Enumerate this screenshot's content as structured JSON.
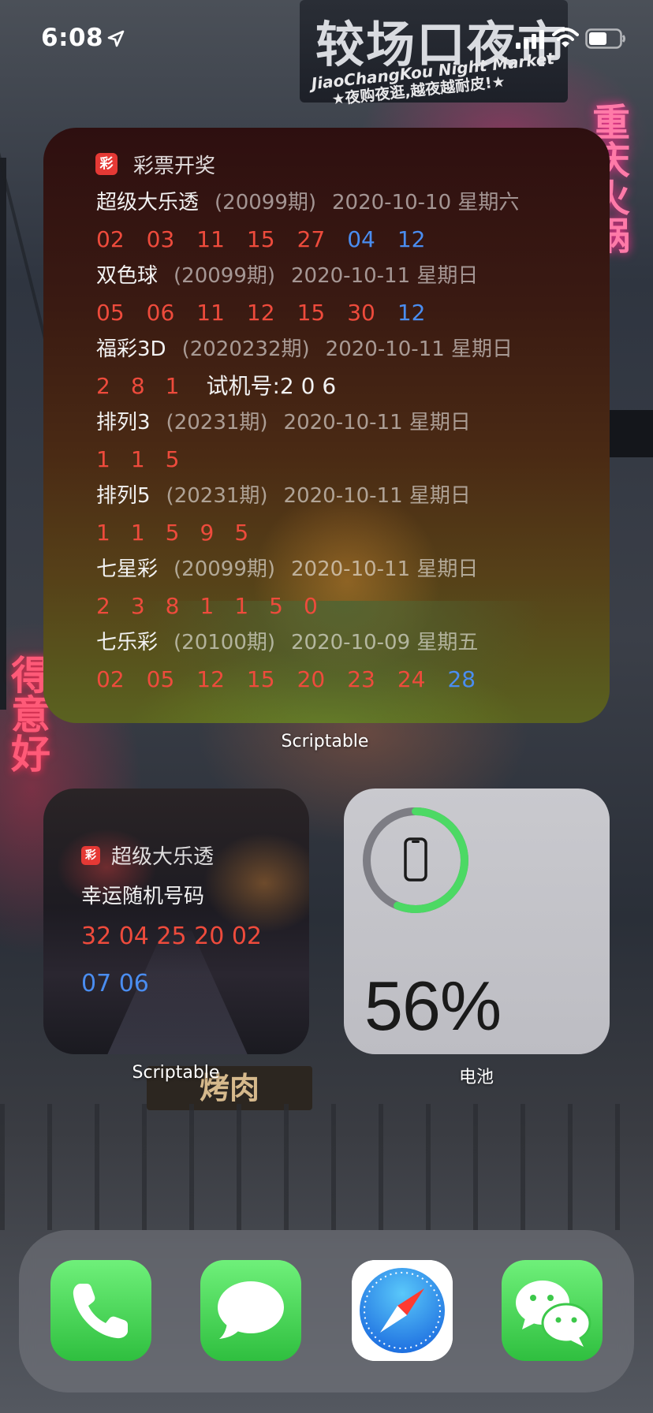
{
  "status_bar": {
    "time": "6:08",
    "icons": [
      "location-icon",
      "signal-icon",
      "wifi-icon",
      "battery-icon"
    ]
  },
  "wallpaper": {
    "sign_big": "较场口夜市",
    "sign_sub1": "JiaoChangKou Night Market",
    "sign_sub2": "★夜购夜逛,越夜越耐皮!★",
    "left_neon": "得意好",
    "right_neon": "重庆火锅",
    "bbq_sign": "烤肉"
  },
  "lottery_widget": {
    "badge": "彩",
    "title": "彩票开奖",
    "app_label": "Scriptable",
    "entries": [
      {
        "name": "超级大乐透",
        "issue": "(20099期)",
        "date": "2020-10-10 星期六",
        "red": [
          "02",
          "03",
          "11",
          "15",
          "27"
        ],
        "blue": [
          "04",
          "12"
        ],
        "trial": ""
      },
      {
        "name": "双色球",
        "issue": "(20099期)",
        "date": "2020-10-11 星期日",
        "red": [
          "05",
          "06",
          "11",
          "12",
          "15",
          "30"
        ],
        "blue": [
          "12"
        ],
        "trial": ""
      },
      {
        "name": "福彩3D",
        "issue": "(2020232期)",
        "date": "2020-10-11 星期日",
        "red": [
          "2",
          "8",
          "1"
        ],
        "blue": [],
        "trial": "试机号:2 0 6"
      },
      {
        "name": "排列3",
        "issue": "(20231期)",
        "date": "2020-10-11 星期日",
        "red": [
          "1",
          "1",
          "5"
        ],
        "blue": [],
        "trial": ""
      },
      {
        "name": "排列5",
        "issue": "(20231期)",
        "date": "2020-10-11 星期日",
        "red": [
          "1",
          "1",
          "5",
          "9",
          "5"
        ],
        "blue": [],
        "trial": ""
      },
      {
        "name": "七星彩",
        "issue": "(20099期)",
        "date": "2020-10-11 星期日",
        "red": [
          "2",
          "3",
          "8",
          "1",
          "1",
          "5",
          "0"
        ],
        "blue": [],
        "trial": ""
      },
      {
        "name": "七乐彩",
        "issue": "(20100期)",
        "date": "2020-10-09 星期五",
        "red": [
          "02",
          "05",
          "12",
          "15",
          "20",
          "23",
          "24"
        ],
        "blue": [
          "28"
        ],
        "trial": ""
      }
    ]
  },
  "random_widget": {
    "badge": "彩",
    "title": "超级大乐透",
    "subtitle": "幸运随机号码",
    "red_numbers": "32 04 25 20 02",
    "blue_numbers": "07 06",
    "app_label": "Scriptable"
  },
  "battery_widget": {
    "percent": "56%",
    "level": 0.56,
    "ring_color": "#4cd964",
    "app_label": "电池"
  },
  "dock": {
    "apps": [
      {
        "name": "phone",
        "icon": "phone-icon",
        "color": "#4cd964"
      },
      {
        "name": "messages",
        "icon": "messages-icon",
        "color": "#4cd964"
      },
      {
        "name": "safari",
        "icon": "safari-icon",
        "color": "#1e88e5"
      },
      {
        "name": "wechat",
        "icon": "wechat-icon",
        "color": "#4cd964"
      }
    ]
  },
  "colors": {
    "red_ball": "#ee4b3c",
    "blue_ball": "#4a8df0"
  }
}
